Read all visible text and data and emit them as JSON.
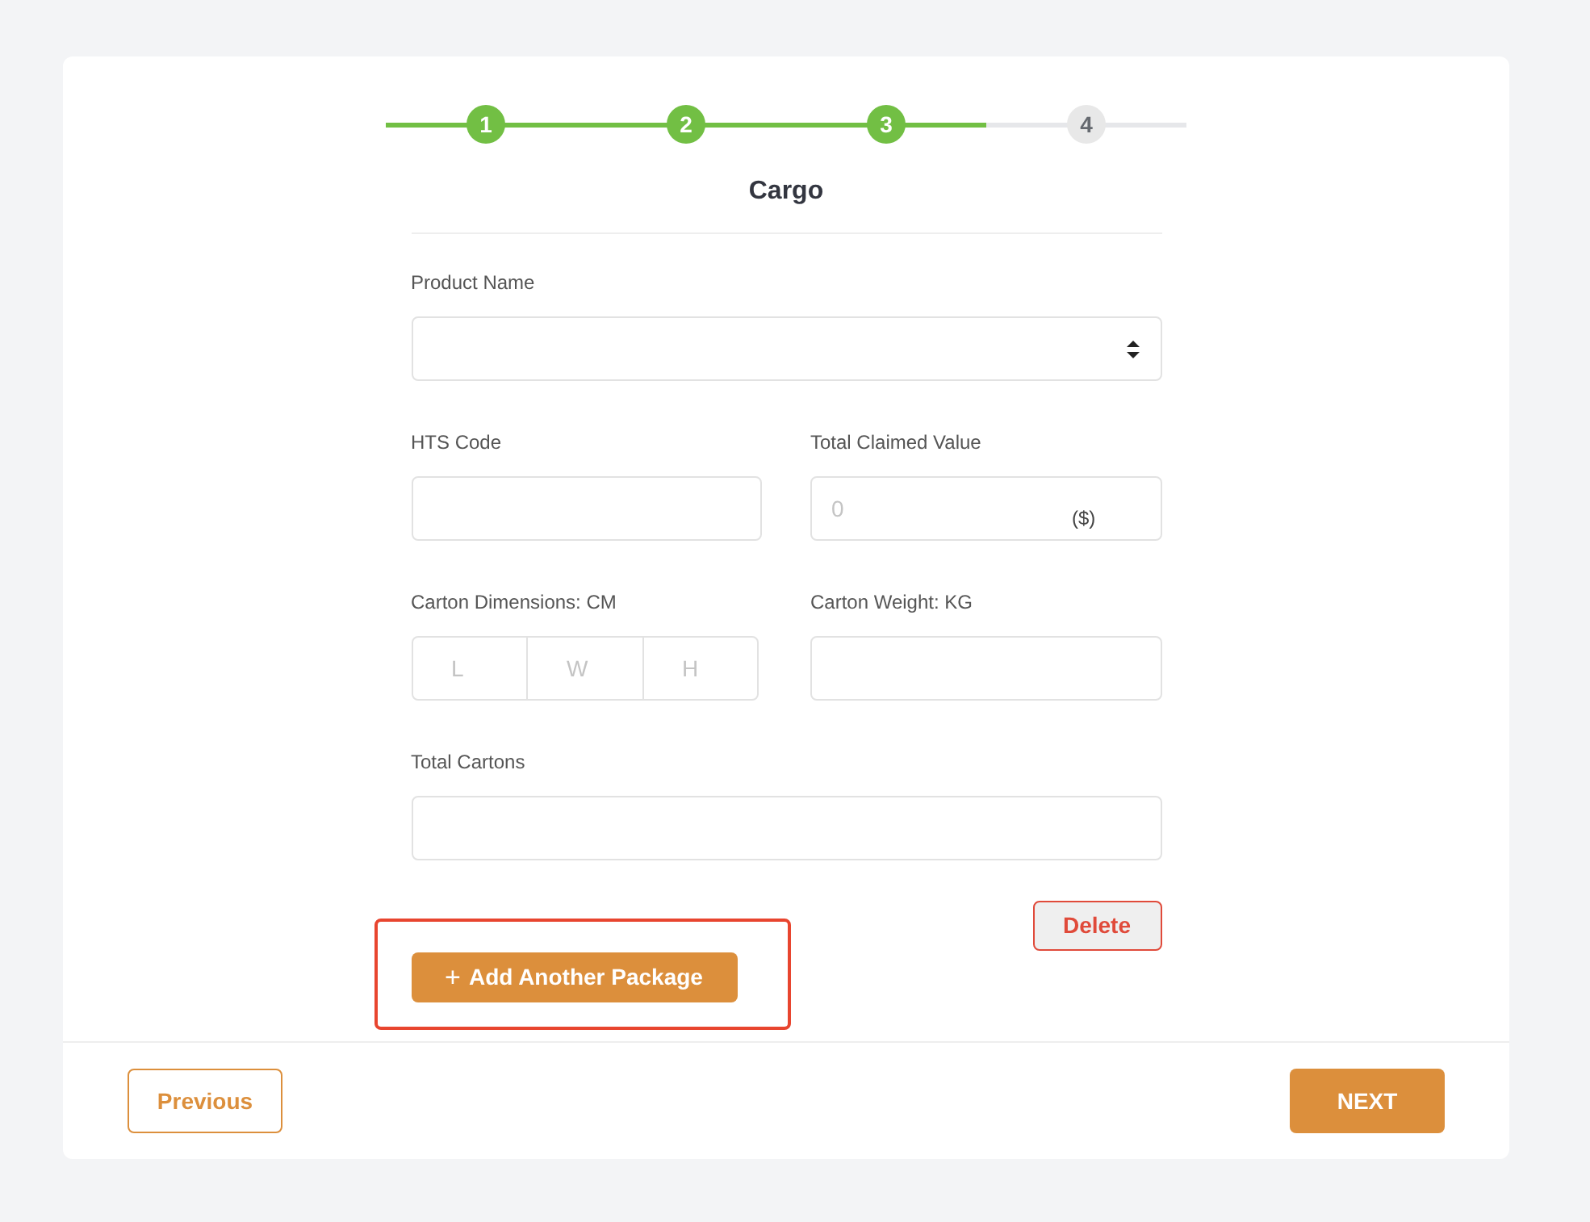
{
  "steps": [
    {
      "label": "1",
      "completed": true
    },
    {
      "label": "2",
      "completed": true
    },
    {
      "label": "3",
      "completed": true
    },
    {
      "label": "4",
      "completed": false
    }
  ],
  "section_title": "Cargo",
  "product_name": {
    "label": "Product Name"
  },
  "hts_code": {
    "label": "HTS Code"
  },
  "total_claimed_value": {
    "label": "Total Claimed Value",
    "placeholder": "0",
    "unit": "($)"
  },
  "carton_dimensions": {
    "label": "Carton Dimensions: CM",
    "placeholders": [
      "L",
      "W",
      "H"
    ]
  },
  "carton_weight": {
    "label": "Carton Weight: KG"
  },
  "total_cartons": {
    "label": "Total Cartons"
  },
  "delete_button": "Delete",
  "add_package_button": {
    "plus": "+",
    "label": "Add Another Package",
    "highlighted": true
  },
  "previous_button": "Previous",
  "next_button": "NEXT"
}
